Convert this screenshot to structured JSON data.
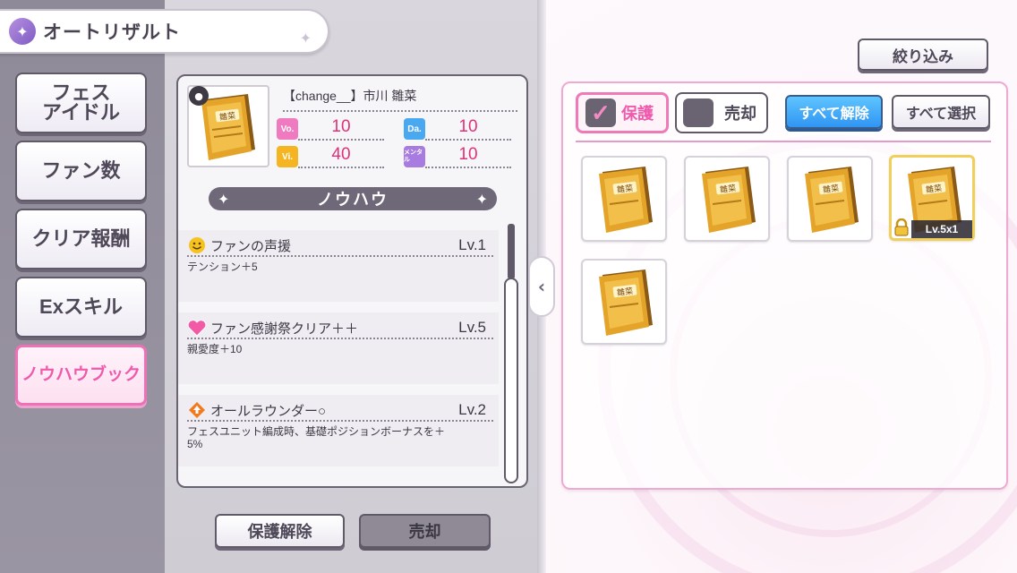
{
  "header": {
    "title": "オートリザルト",
    "icon": "sparkle-face-icon"
  },
  "sidebar": {
    "items": [
      {
        "label_line1": "フェス",
        "label_line2": "アイドル"
      },
      {
        "label": "ファン数"
      },
      {
        "label": "クリア報酬"
      },
      {
        "label": "Exスキル"
      },
      {
        "label": "ノウハウブック",
        "active": true
      }
    ]
  },
  "detail": {
    "name": "【change__】市川 雛菜",
    "badge_icon": "bomb-icon",
    "book_title": "雛菜",
    "stats": [
      {
        "label": "Vo.",
        "value": "10",
        "color": "#f07ac0"
      },
      {
        "label": "Da.",
        "value": "10",
        "color": "#4aa8f0"
      },
      {
        "label": "Vi.",
        "value": "40",
        "color": "#f5b522"
      },
      {
        "label": "メンタル",
        "value": "10",
        "color": "#a77be0"
      }
    ],
    "section_title": "ノウハウ",
    "skills": [
      {
        "icon": "smile-icon",
        "name": "ファンの声援",
        "level": "Lv.1",
        "desc": "テンション＋5"
      },
      {
        "icon": "heart-icon",
        "name": "ファン感謝祭クリア＋＋",
        "level": "Lv.5",
        "desc": "親愛度＋10"
      },
      {
        "icon": "arrow-up-diamond-icon",
        "name": "オールラウンダー○",
        "level": "Lv.2",
        "desc": "フェスユニット編成時、基礎ポジションボーナスを＋5%"
      }
    ]
  },
  "buttons": {
    "release_protect": "保護解除",
    "sell": "売却"
  },
  "right": {
    "filter": "絞り込み",
    "protect_toggle": "保護",
    "sell_toggle": "売却",
    "clear_all": "すべて解除",
    "select_all": "すべて選択",
    "items": [
      {
        "title": "雛菜",
        "selected": false
      },
      {
        "title": "雛菜",
        "selected": false
      },
      {
        "title": "雛菜",
        "selected": false
      },
      {
        "title": "雛菜",
        "selected": true,
        "locked": true,
        "level": "Lv.5x1"
      },
      {
        "title": "雛菜",
        "selected": false
      }
    ]
  },
  "colors": {
    "accent_pink": "#ef5aac",
    "accent_blue": "#2f95f2"
  }
}
